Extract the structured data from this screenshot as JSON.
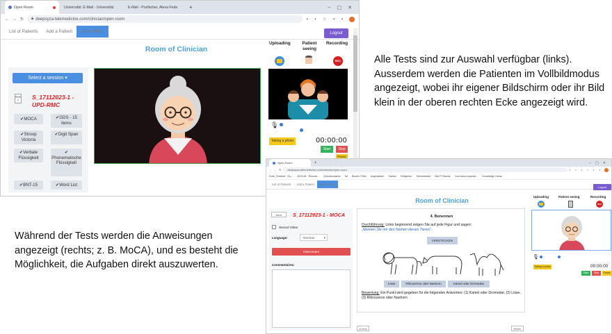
{
  "captions": {
    "right": "Alle Tests sind zur Auswahl verfügbar (links). Ausserdem werden die Patienten im Vollbildmodus angezeigt, wobei ihr eigener Bildschirm oder ihr Bild klein in der oberen rechten Ecke angezeigt wird.",
    "left": "Während der Tests werden die Anweisungen angezeigt (rechts; z. B. MoCA), und es besteht die Möglichkeit, die Aufgaben direkt auszuwerten."
  },
  "shot1": {
    "tabs": [
      "Open Room",
      "Universität: E-Mail - Universität",
      "E-Mail - Posfächer, Alexa Fede"
    ],
    "url": "deepsyza-telemedicine.com/clinician/open-room",
    "nav": [
      "List of Patients",
      "Add a Patient",
      "Open Room"
    ],
    "logout": "Logout",
    "title": "Room of Clinician",
    "select_session": "Select a session ▾",
    "reset": "Res t",
    "session_id": "S_17112023-1 -",
    "session_name": "UPD-RMC",
    "tests": [
      "MOCA",
      "GDS - 15 items",
      "Stroop Victoria",
      "Digit Span",
      "Verbale Flüssigkeit",
      "Phonematische Flüssigkeit",
      "BNT-15",
      "Word List"
    ],
    "uploading": "Uploading",
    "patient_seeing": "Patient seeing",
    "recording": "Recording",
    "rec": "REC",
    "taking_photo": "Taking a photo",
    "timer": "00:00:00",
    "start": "Start",
    "stop": "Stop",
    "pause": "Pause"
  },
  "shot2": {
    "tabs": [
      "Open Room"
    ],
    "url": "deepsyza-telemedicine.com/clinician/open-room",
    "bookmarks": [
      "Gute_Timeline · Go...",
      "2023-06 · Remote...",
      "Questionnaires",
      "Tal",
      "Bound / Refs",
      "Angewiesen",
      "Games",
      "Fortgeben",
      "Telemedicine",
      "MoCT Raume",
      "Your store expanse...",
      "Knowledge Home"
    ],
    "nav": [
      "List of Patients",
      "Add a Patient",
      "Open Room"
    ],
    "logout": "Logout",
    "title": "Room of Clinician",
    "back": "Back",
    "session_id": "S_17112023-1 -",
    "session_name": "MOCA",
    "record_video": "Record Video",
    "language_label": "Language:",
    "language_value": "German",
    "interrupt": "Interrompre",
    "comments_label": "Commentaires:",
    "uploading": "Uploading",
    "patient_seeing": "Patient seeing",
    "recording": "Recording",
    "rec": "REC",
    "taking_photo": "Taking a photo",
    "timer": "00:00:00",
    "start": "Start",
    "stop": "Stop",
    "pause": "Pause",
    "task_title": "4. Benennen",
    "instruction_label": "Durchführung:",
    "instruction_text": " Links beginnend zeigen Sie auf jede Figur und sagen:",
    "instruction_quote": "„Nennen Sie mir den Namen dieses Tieres\".",
    "hide_button": "VERSTECKEN",
    "answers": [
      "Löwe",
      "Rhinozeros oder Nashorn",
      "Kamel oder Dromedar"
    ],
    "scoring_label": "Bewertung:",
    "scoring_text": " Ein Punkt wird gegeben für die folgenden Antworten: (1) Kamel oder Dromedar, (2) Löwe, (3) Rhinozeros oder Nashorn",
    "prev": "Zurück",
    "next": "Weiter"
  }
}
